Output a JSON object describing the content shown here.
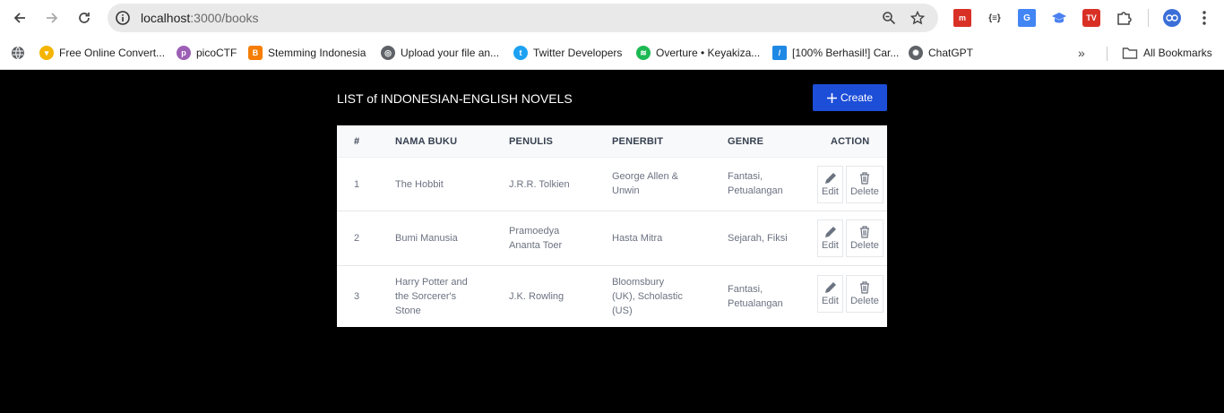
{
  "browser": {
    "url_host": "localhost",
    "url_path": ":3000/books",
    "bookmarks": [
      {
        "label": "Free Online Convert...",
        "icon": "convert-icon",
        "color": "#f4b400"
      },
      {
        "label": "picoCTF",
        "icon": "picoctf-icon",
        "color": "#9c5fb5"
      },
      {
        "label": "Stemming Indonesia",
        "icon": "blogger-icon",
        "color": "#f57d00"
      },
      {
        "label": "Upload your file an...",
        "icon": "globe-icon",
        "color": "#5f6368"
      },
      {
        "label": "Twitter Developers",
        "icon": "twitter-icon",
        "color": "#1da1f2"
      },
      {
        "label": "Overture • Keyakiza...",
        "icon": "spotify-icon",
        "color": "#1db954"
      },
      {
        "label": "[100% Berhasil!] Car...",
        "icon": "feather-icon",
        "color": "#1e88e5"
      },
      {
        "label": "ChatGPT",
        "icon": "chatgpt-icon",
        "color": "#5f6368"
      }
    ],
    "all_bookmarks": "All Bookmarks"
  },
  "page": {
    "title": "LIST of INDONESIAN-ENGLISH NOVELS",
    "create_label": "Create"
  },
  "table": {
    "headers": [
      "#",
      "NAMA BUKU",
      "PENULIS",
      "PENERBIT",
      "GENRE",
      "ACTION"
    ],
    "edit_label": "Edit",
    "delete_label": "Delete",
    "rows": [
      {
        "no": "1",
        "title": [
          "The Hobbit"
        ],
        "author": [
          "J.R.R. Tolkien"
        ],
        "publisher": [
          "George Allen &",
          "Unwin"
        ],
        "genre": [
          "Fantasi,",
          "Petualangan"
        ]
      },
      {
        "no": "2",
        "title": [
          "Bumi Manusia"
        ],
        "author": [
          "Pramoedya",
          "Ananta Toer"
        ],
        "publisher": [
          "Hasta Mitra"
        ],
        "genre": [
          "Sejarah, Fiksi"
        ]
      },
      {
        "no": "3",
        "title": [
          "Harry Potter and",
          "the Sorcerer's",
          "Stone"
        ],
        "author": [
          "J.K. Rowling"
        ],
        "publisher": [
          "Bloomsbury",
          "(UK), Scholastic",
          "(US)"
        ],
        "genre": [
          "Fantasi,",
          "Petualangan"
        ]
      }
    ]
  }
}
